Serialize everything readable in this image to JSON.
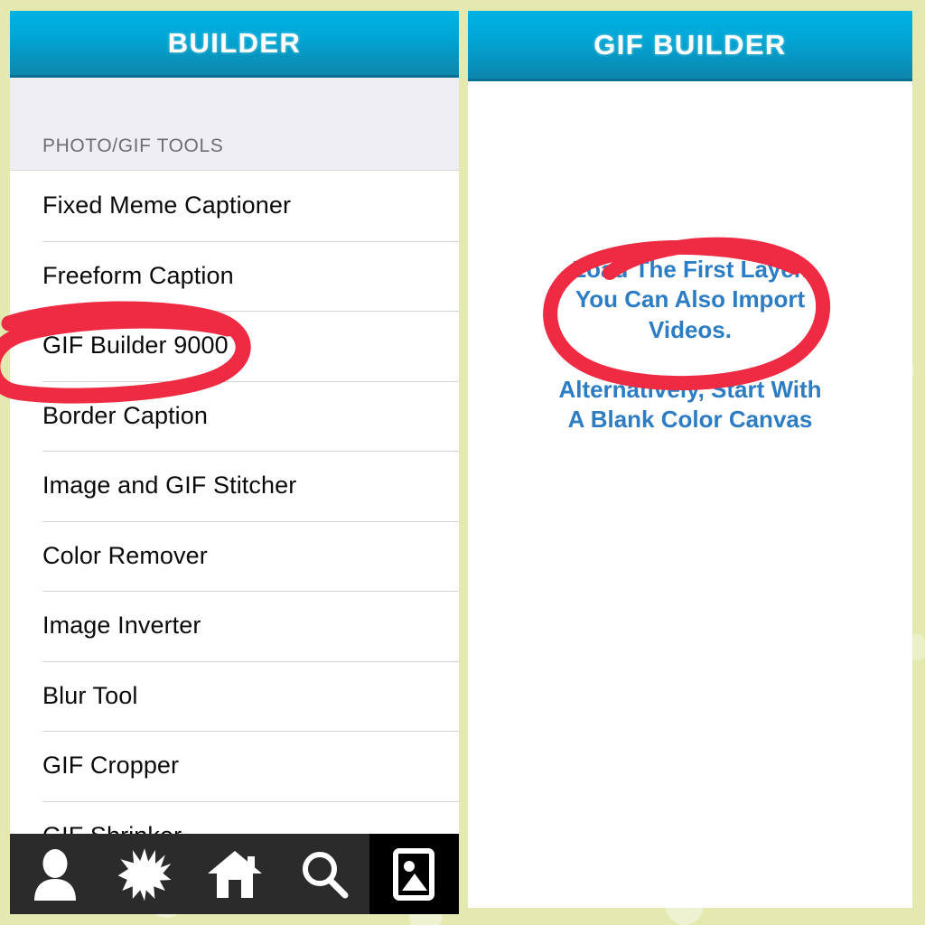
{
  "theme": {
    "background": "#e4e9b0",
    "nav_blue_top": "#00b3e3",
    "nav_blue_bottom": "#0c86ac",
    "marker_red": "#ee2b42",
    "hint_blue": "#2d7dc5",
    "tab_bar_black": "#2b2b2b",
    "list_text": "#0b0b0b",
    "section_header_bg": "#eeeef4",
    "section_header_text": "#6d6d72"
  },
  "left_panel": {
    "nav_title": "BUILDER",
    "section_header": "PHOTO/GIF TOOLS",
    "tools": [
      {
        "label": "Fixed Meme Captioner"
      },
      {
        "label": "Freeform Caption"
      },
      {
        "label": "GIF Builder 9000"
      },
      {
        "label": "Border Caption"
      },
      {
        "label": "Image and GIF Stitcher"
      },
      {
        "label": "Color Remover"
      },
      {
        "label": "Image Inverter"
      },
      {
        "label": "Blur Tool"
      },
      {
        "label": "GIF Cropper"
      },
      {
        "label": "GIF Shrinker"
      }
    ],
    "tab_bar": {
      "items": [
        {
          "icon": "person-icon",
          "active": false
        },
        {
          "icon": "starburst-icon",
          "active": false
        },
        {
          "icon": "home-icon",
          "active": false
        },
        {
          "icon": "search-icon",
          "active": false
        },
        {
          "icon": "photo-icon",
          "active": true
        }
      ]
    }
  },
  "right_panel": {
    "nav_title": "GIF BUILDER",
    "hint_primary_line1": "Load The First Layer.",
    "hint_primary_line2": "You Can Also Import",
    "hint_primary_line3": "Videos.",
    "hint_secondary_line1": "Alternatively, Start With",
    "hint_secondary_line2": "A Blank Color Canvas"
  },
  "annotations": [
    {
      "name": "red-circle-gif-builder-9000",
      "target": "GIF Builder 9000"
    },
    {
      "name": "red-circle-load-first-layer",
      "target": "Load The First Layer. You Can Also Import Videos."
    }
  ]
}
